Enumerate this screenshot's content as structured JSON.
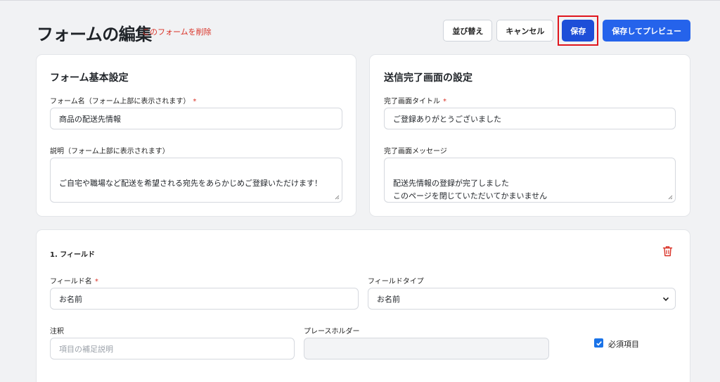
{
  "header": {
    "title": "フォームの編集",
    "delete_link": "このフォームを削除",
    "buttons": {
      "sort": "並び替え",
      "cancel": "キャンセル",
      "save": "保存",
      "save_preview": "保存してプレビュー"
    }
  },
  "basic_settings": {
    "title": "フォーム基本設定",
    "form_name_label": "フォーム名（フォーム上部に表示されます）",
    "required_mark": "*",
    "form_name_value": "商品の配送先情報",
    "description_label": "説明（フォーム上部に表示されます）",
    "description_value": "ご自宅や職場など配送を希望される宛先をあらかじめご登録いただけます！"
  },
  "completion_settings": {
    "title": "送信完了画面の設定",
    "title_label": "完了画面タイトル",
    "required_mark": "*",
    "title_value": "ご登録ありがとうございました",
    "message_label": "完了画面メッセージ",
    "message_value": "配送先情報の登録が完了しました\nこのページを閉じていただいてかまいません"
  },
  "field": {
    "heading": "1. フィールド",
    "name_label": "フィールド名",
    "required_mark": "*",
    "name_value": "お名前",
    "type_label": "フィールドタイプ",
    "type_value": "お名前",
    "note_label": "注釈",
    "note_placeholder": "項目の補足説明",
    "placeholder_label": "プレースホルダー",
    "required_checkbox_label": "必須項目",
    "required_checked": true
  },
  "colors": {
    "primary": "#2563eb",
    "save": "#1d4ed8",
    "danger": "#d93025",
    "highlight": "#e0161e",
    "checkbox": "#1a73e8"
  }
}
